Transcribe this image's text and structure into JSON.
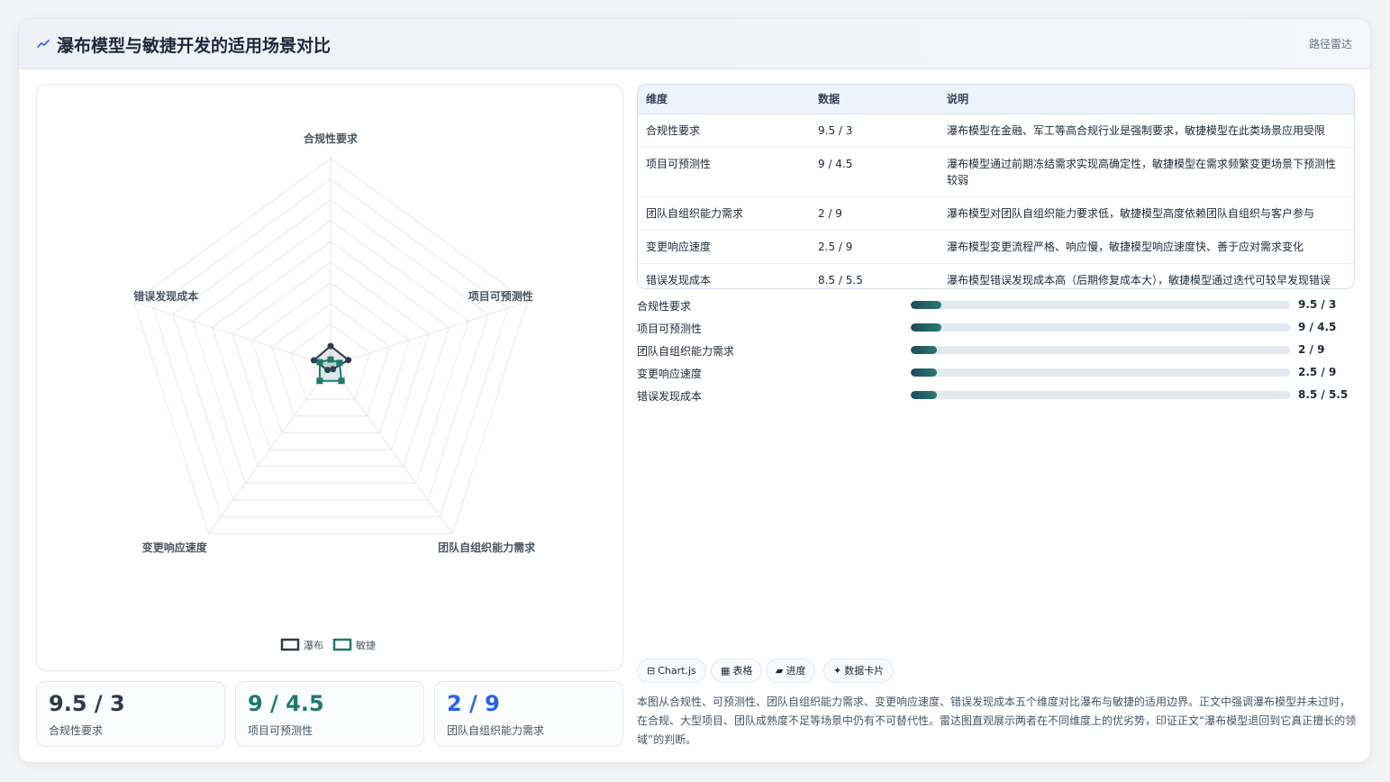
{
  "header": {
    "icon": "trend-icon",
    "title": "瀑布模型与敏捷开发的适用场景对比",
    "tag": "路径雷达"
  },
  "colors": {
    "waterfall": "#2f3a4c",
    "agile": "#1e7a6e",
    "accent_blue": "#2563eb",
    "bar_fill": "#1e4a5a"
  },
  "chart_data": {
    "type": "radar",
    "axes": [
      "合规性要求",
      "项目可预测性",
      "团队自组织能力需求",
      "变更响应速度",
      "错误发现成本"
    ],
    "range": [
      0,
      100
    ],
    "grid_levels": 10,
    "series": [
      {
        "name": "瀑布",
        "values": [
          9.5,
          9,
          2,
          2.5,
          8.5
        ]
      },
      {
        "name": "敏捷",
        "values": [
          3,
          4.5,
          9,
          9,
          5.5
        ]
      }
    ],
    "legend_position": "bottom-center"
  },
  "stats": [
    {
      "value": "9.5 / 3",
      "label": "合规性要求",
      "color": "#2f3a4c"
    },
    {
      "value": "9 / 4.5",
      "label": "项目可预测性",
      "color": "#1e7a6e"
    },
    {
      "value": "2 / 9",
      "label": "团队自组织能力需求",
      "color": "#2563eb"
    }
  ],
  "table": {
    "headers": [
      "维度",
      "数据",
      "说明"
    ],
    "rows": [
      [
        "合规性要求",
        "9.5 / 3",
        "瀑布模型在金融、军工等高合规行业是强制要求，敏捷模型在此类场景应用受限"
      ],
      [
        "项目可预测性",
        "9 / 4.5",
        "瀑布模型通过前期冻结需求实现高确定性，敏捷模型在需求频繁变更场景下预测性较弱"
      ],
      [
        "团队自组织能力需求",
        "2 / 9",
        "瀑布模型对团队自组织能力要求低，敏捷模型高度依赖团队自组织与客户参与"
      ],
      [
        "变更响应速度",
        "2.5 / 9",
        "瀑布模型变更流程严格、响应慢，敏捷模型响应速度快、善于应对需求变化"
      ],
      [
        "错误发现成本",
        "8.5 / 5.5",
        "瀑布模型错误发现成本高（后期修复成本大），敏捷模型通过迭代可较早发现错误"
      ]
    ]
  },
  "bars": [
    {
      "label": "合规性要求",
      "value_text": "9.5 / 3",
      "fraction": 0.08
    },
    {
      "label": "项目可预测性",
      "value_text": "9 / 4.5",
      "fraction": 0.08
    },
    {
      "label": "团队自组织能力需求",
      "value_text": "2 / 9",
      "fraction": 0.07
    },
    {
      "label": "变更响应速度",
      "value_text": "2.5 / 9",
      "fraction": 0.07
    },
    {
      "label": "错误发现成本",
      "value_text": "8.5 / 5.5",
      "fraction": 0.07
    }
  ],
  "chips": [
    {
      "icon": "chart-icon",
      "glyph": "⊟",
      "label": "Chart.js"
    },
    {
      "icon": "table-icon",
      "glyph": "▦",
      "label": "表格"
    },
    {
      "icon": "progress-icon",
      "glyph": "▰",
      "label": "进度"
    },
    {
      "icon": "sparkle-icon",
      "glyph": "✦",
      "label": "数据卡片"
    }
  ],
  "description": "本图从合规性、可预测性、团队自组织能力需求、变更响应速度、错误发现成本五个维度对比瀑布与敏捷的适用边界。正文中强调瀑布模型并未过时，在合规、大型项目、团队成熟度不足等场景中仍有不可替代性。雷达图直观展示两者在不同维度上的优劣势，印证正文“瀑布模型退回到它真正擅长的领域”的判断。"
}
